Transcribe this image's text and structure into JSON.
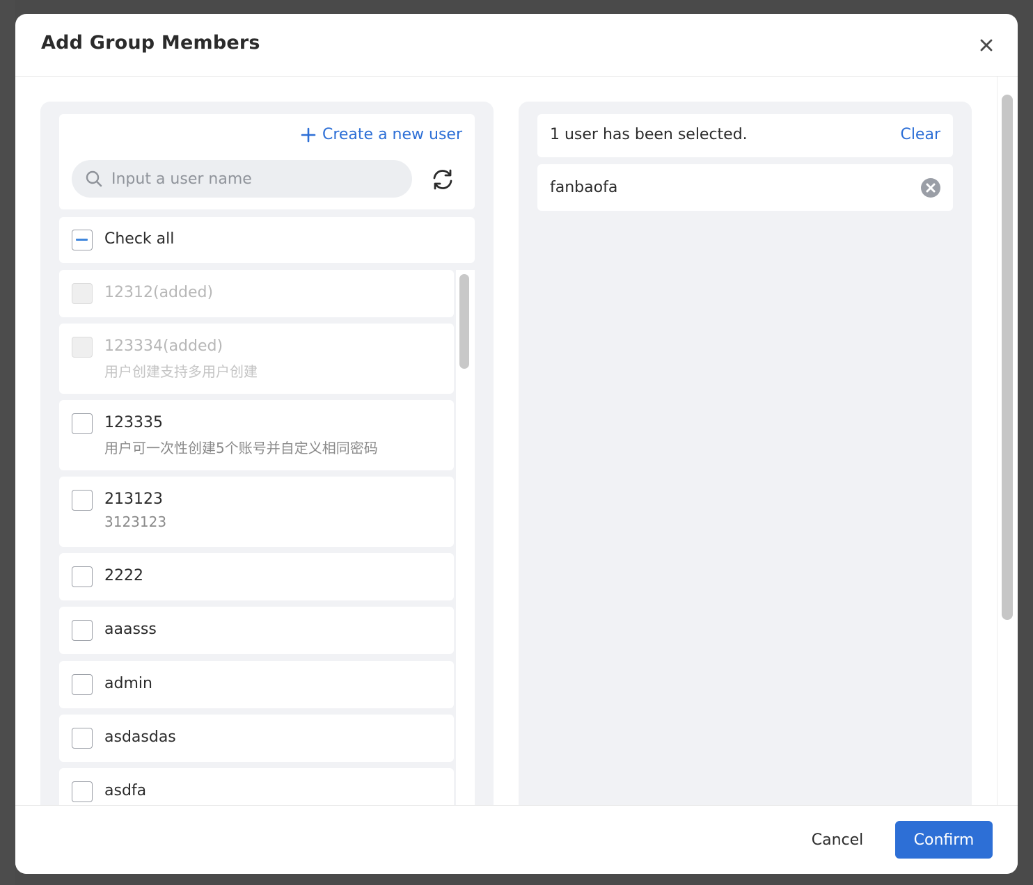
{
  "modal": {
    "title": "Add Group Members"
  },
  "left_panel": {
    "create_user_label": "Create a new user",
    "search_placeholder": "Input a user name",
    "check_all_label": "Check all",
    "users": [
      {
        "name": "12312(added)",
        "description": "",
        "added": true,
        "checked": false
      },
      {
        "name": "123334(added)",
        "description": "用户创建支持多用户创建",
        "added": true,
        "checked": false
      },
      {
        "name": "123335",
        "description": "用户可一次性创建5个账号并自定义相同密码",
        "added": false,
        "checked": false
      },
      {
        "name": "213123",
        "description": "3123123",
        "added": false,
        "checked": false
      },
      {
        "name": "2222",
        "description": "",
        "added": false,
        "checked": false
      },
      {
        "name": "aaasss",
        "description": "",
        "added": false,
        "checked": false
      },
      {
        "name": "admin",
        "description": "",
        "added": false,
        "checked": false
      },
      {
        "name": "asdasdas",
        "description": "",
        "added": false,
        "checked": false
      },
      {
        "name": "asdfa",
        "description": "",
        "added": false,
        "checked": false
      }
    ]
  },
  "right_panel": {
    "selected_count_text": "1 user has been selected.",
    "clear_label": "Clear",
    "selected_users": [
      "fanbaofa"
    ]
  },
  "footer": {
    "cancel_label": "Cancel",
    "confirm_label": "Confirm"
  },
  "colors": {
    "accent": "#2d6fd6",
    "panel_bg": "#f1f2f5",
    "indeterminate": "#3f86dc"
  },
  "icons": [
    "close-icon",
    "plus-icon",
    "search-icon",
    "refresh-icon",
    "remove-circle-icon"
  ]
}
